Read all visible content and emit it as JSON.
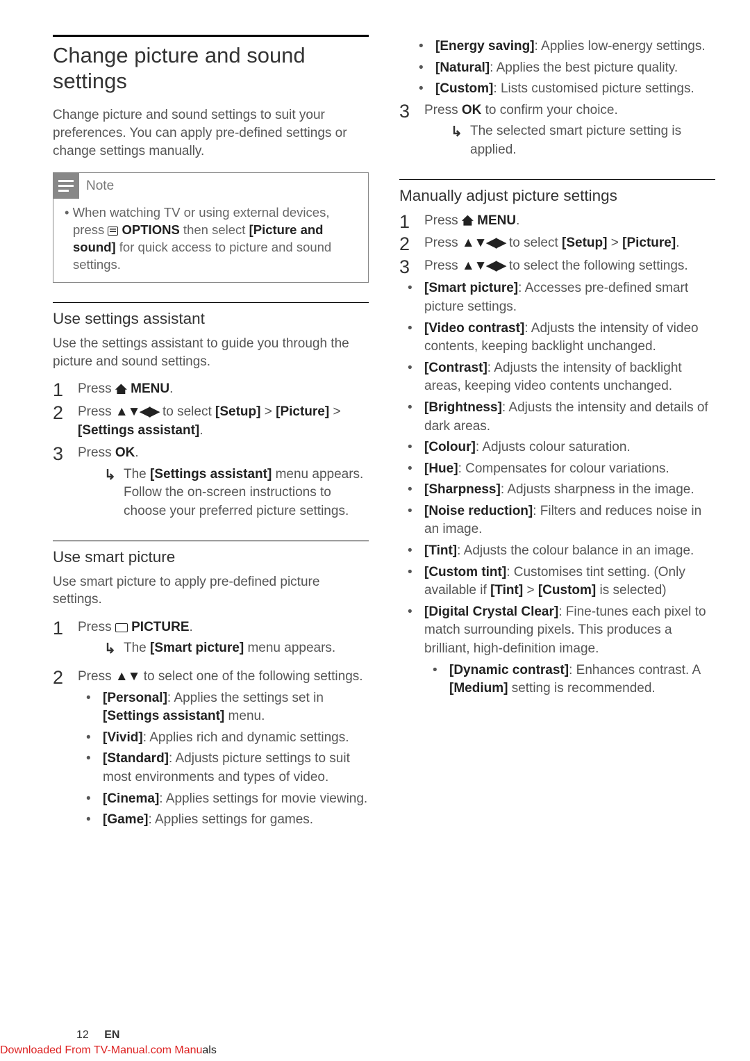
{
  "left": {
    "rule": true,
    "heading": "Change picture and sound settings",
    "intro": "Change picture and sound settings to suit your preferences. You can apply pre-defined settings or change settings manually.",
    "note": {
      "title": "Note",
      "body_parts": [
        "• When watching TV or using external devices, press ",
        " OPTIONS",
        " then select ",
        "[Picture and sound]",
        " for quick access to picture and sound settings."
      ]
    },
    "sec1": {
      "heading": "Use settings assistant",
      "intro": "Use the settings assistant to guide you through the picture and sound settings.",
      "steps": {
        "s1": [
          "Press ",
          " MENU",
          "."
        ],
        "s2": [
          "Press ",
          "▲▼◀▶",
          " to select ",
          "[Setup]",
          " > ",
          "[Picture]",
          " > ",
          "[Settings assistant]",
          "."
        ],
        "s3": [
          "Press ",
          "OK",
          "."
        ],
        "s3_result": [
          "The ",
          "[Settings assistant]",
          " menu appears. Follow the on-screen instructions to choose your preferred picture settings."
        ]
      }
    },
    "sec2": {
      "heading": "Use smart picture",
      "intro": "Use smart picture to apply pre-defined picture settings.",
      "steps": {
        "s1": [
          "Press ",
          " PICTURE",
          "."
        ],
        "s1_result": [
          "The ",
          "[Smart picture]",
          " menu appears."
        ],
        "s2": [
          "Press ",
          "▲▼",
          " to select one of the following settings."
        ],
        "s2_items": [
          {
            "b": "[Personal]",
            "t": ": Applies the settings set in ",
            "b2": "[Settings assistant]",
            "t2": " menu."
          },
          {
            "b": "[Vivid]",
            "t": ": Applies rich and dynamic settings."
          },
          {
            "b": "[Standard]",
            "t": ": Adjusts picture settings to suit most environments and types of video."
          },
          {
            "b": "[Cinema]",
            "t": ": Applies settings for movie viewing."
          },
          {
            "b": "[Game]",
            "t": ": Applies settings for games."
          }
        ]
      }
    }
  },
  "right": {
    "top_items": [
      {
        "b": "[Energy saving]",
        "t": ": Applies low-energy settings."
      },
      {
        "b": "[Natural]",
        "t": ": Applies the best picture quality."
      },
      {
        "b": "[Custom]",
        "t": ": Lists customised picture settings."
      }
    ],
    "step3": [
      "Press ",
      "OK",
      " to confirm your choice."
    ],
    "step3_result": "The selected smart picture setting is applied.",
    "sec": {
      "heading": "Manually adjust picture settings",
      "s1": [
        "Press ",
        " MENU",
        "."
      ],
      "s2": [
        "Press ",
        "▲▼◀▶",
        " to select ",
        "[Setup]",
        " > ",
        "[Picture]",
        "."
      ],
      "s3": [
        "Press ",
        "▲▼◀▶",
        " to select the following settings."
      ],
      "items": [
        {
          "b": "[Smart picture]",
          "t": ": Accesses pre-defined smart picture settings."
        },
        {
          "b": "[Video contrast]",
          "t": ": Adjusts the intensity of video contents, keeping backlight unchanged."
        },
        {
          "b": "[Contrast]",
          "t": ": Adjusts the intensity of backlight areas, keeping video contents unchanged."
        },
        {
          "b": "[Brightness]",
          "t": ": Adjusts the intensity and details of dark areas."
        },
        {
          "b": "[Colour]",
          "t": ": Adjusts colour saturation."
        },
        {
          "b": "[Hue]",
          "t": ": Compensates for colour variations."
        },
        {
          "b": "[Sharpness]",
          "t": ": Adjusts sharpness in the image."
        },
        {
          "b": "[Noise reduction]",
          "t": ": Filters and reduces noise in an image."
        },
        {
          "b": "[Tint]",
          "t": ": Adjusts the colour balance in an image."
        },
        {
          "b": "[Custom tint]",
          "t": ": Customises tint setting. (Only available if ",
          "b2": "[Tint]",
          "t2": " > ",
          "b3": "[Custom]",
          "t3": " is selected)"
        },
        {
          "b": "[Digital Crystal Clear]",
          "t": ": Fine-tunes each pixel to match surrounding pixels. This produces a brilliant, high-definition image."
        }
      ],
      "subitem": {
        "b": "[Dynamic contrast]",
        "t": ": Enhances contrast. A ",
        "b2": "[Medium]",
        "t2": " setting is recommended."
      }
    }
  },
  "footer": {
    "page": "12",
    "lang": "EN",
    "link_red": "Downloaded From TV-Manual.com Manu",
    "link_black": "als"
  }
}
